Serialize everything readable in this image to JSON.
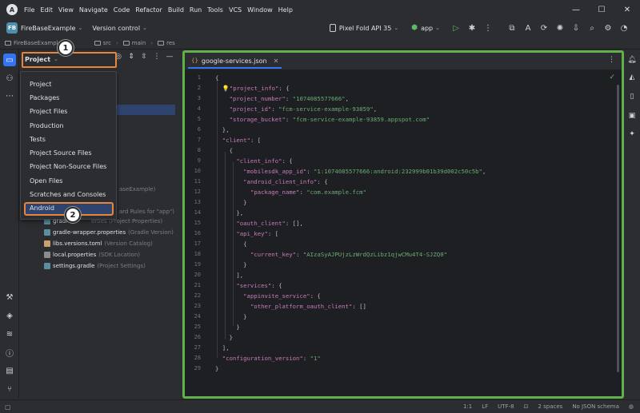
{
  "menu": [
    "File",
    "Edit",
    "View",
    "Navigate",
    "Code",
    "Refactor",
    "Build",
    "Run",
    "Tools",
    "VCS",
    "Window",
    "Help"
  ],
  "toolbar": {
    "project_badge": "FB",
    "project_name": "FireBaseExample",
    "vcs_label": "Version control",
    "device": "Pixel Fold API 35",
    "run_config": "app"
  },
  "breadcrumb": [
    "FireBaseExample",
    "src",
    "main",
    "res"
  ],
  "project_panel": {
    "title": "Project",
    "dropdown_items": [
      "Project",
      "Packages",
      "Project Files",
      "Production",
      "Tests",
      "Project Source Files",
      "Project Non-Source Files",
      "Open Files",
      "Scratches and Consoles",
      "Android"
    ],
    "selected_item": "Android",
    "tree_partial": [
      {
        "name": "aseExample)",
        "note": ""
      },
      {
        "name": "ard Rules for \"app\")",
        "note": ""
      },
      {
        "name": "gradl",
        "note": "erties (Project Properties)"
      },
      {
        "name": "gradle-wrapper.properties",
        "note": "(Gradle Version)"
      },
      {
        "name": "libs.versions.toml",
        "note": "(Version Catalog)"
      },
      {
        "name": "local.properties",
        "note": "(SDK Location)"
      },
      {
        "name": "settings.gradle",
        "note": "(Project Settings)"
      }
    ]
  },
  "callouts": {
    "step1": "1",
    "step2": "2"
  },
  "editor": {
    "tab_name": "google-services.json",
    "line_count": 29
  },
  "status": {
    "position": "1:1",
    "line_sep": "LF",
    "encoding": "UTF-8",
    "indent": "2 spaces",
    "schema": "No JSON schema"
  },
  "colors": {
    "accent": "#3574f0",
    "highlight_orange": "#e8853d",
    "editor_border": "#5fb24a"
  }
}
